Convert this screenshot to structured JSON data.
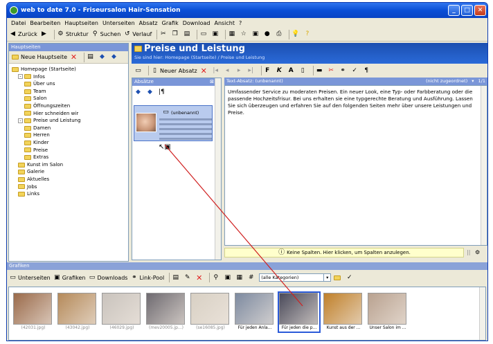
{
  "window": {
    "title": "web to date 7.0 - Friseursalon Hair-Sensation"
  },
  "menu": [
    "Datei",
    "Bearbeiten",
    "Hauptseiten",
    "Unterseiten",
    "Absatz",
    "Grafik",
    "Download",
    "Ansicht",
    "?"
  ],
  "toolbar": {
    "back": "Zurück",
    "structure": "Struktur",
    "search": "Suchen",
    "history": "Verlauf"
  },
  "left": {
    "header": "Hauptseiten",
    "new_page": "Neue Hauptseite",
    "tree": [
      {
        "label": "Homepage (Startseite)",
        "level": 0,
        "toggle": ""
      },
      {
        "label": "Infos",
        "level": 1,
        "toggle": "-"
      },
      {
        "label": "Über uns",
        "level": 2,
        "toggle": ""
      },
      {
        "label": "Team",
        "level": 2,
        "toggle": ""
      },
      {
        "label": "Salon",
        "level": 2,
        "toggle": ""
      },
      {
        "label": "Öffnungszeiten",
        "level": 2,
        "toggle": ""
      },
      {
        "label": "Hier schneiden wir",
        "level": 2,
        "toggle": ""
      },
      {
        "label": "Preise und Leistung",
        "level": 1,
        "toggle": "-"
      },
      {
        "label": "Damen",
        "level": 2,
        "toggle": ""
      },
      {
        "label": "Herren",
        "level": 2,
        "toggle": ""
      },
      {
        "label": "Kinder",
        "level": 2,
        "toggle": ""
      },
      {
        "label": "Preise",
        "level": 2,
        "toggle": ""
      },
      {
        "label": "Extras",
        "level": 2,
        "toggle": ""
      },
      {
        "label": "Kunst im Salon",
        "level": 1,
        "toggle": ""
      },
      {
        "label": "Galerie",
        "level": 1,
        "toggle": ""
      },
      {
        "label": "Aktuelles",
        "level": 1,
        "toggle": ""
      },
      {
        "label": "Jobs",
        "level": 1,
        "toggle": ""
      },
      {
        "label": "Links",
        "level": 1,
        "toggle": ""
      }
    ]
  },
  "page": {
    "title": "Preise und Leistung",
    "breadcrumb": "Sie sind hier: Homepage (Startseite) / Preise und Leistung",
    "new_paragraph": "Neuer Absatz"
  },
  "absatz": {
    "header": "Absätze",
    "card_label": "(unbenannt)"
  },
  "text": {
    "header": "Text-Absatz: (unbenannt)",
    "assign": "(nicht zugeordnet)",
    "pager": "1/1",
    "body": "Umfassender Service zu moderaten Preisen. Ein neuer Look, eine Typ- oder Farbberatung oder die passende Hochzeitsfrisur. Bei uns erhalten sie eine typgerechte Beratung und Ausführung. Lassen Sie sich überzeugen und erfahren Sie auf den folgenden Seiten mehr über unsere Leistungen und Preise.",
    "spalten": "Keine Spalten. Hier klicken, um Spalten anzulegen."
  },
  "grafiken": {
    "header": "Grafiken",
    "tabs": [
      "Unterseiten",
      "Grafiken",
      "Downloads",
      "Link-Pool"
    ],
    "category": "(alle Kategorien)",
    "thumbs": [
      {
        "cap": "(42031.jpg)",
        "gray": true,
        "color": "#9a6a4a"
      },
      {
        "cap": "(43042.jpg)",
        "gray": true,
        "color": "#b58a5a"
      },
      {
        "cap": "(46029.jpg)",
        "gray": true,
        "color": "#c9c3bd"
      },
      {
        "cap": "(mev20005.jp...)",
        "gray": true,
        "color": "#6e6a70"
      },
      {
        "cap": "(se16085.jpg)",
        "gray": true,
        "color": "#d8d0c4"
      },
      {
        "cap": "Für jeden Anla...",
        "gray": false,
        "color": "#7d8aa0"
      },
      {
        "cap": "Für jeden die p...",
        "gray": false,
        "color": "#4a4a5a"
      },
      {
        "cap": "Kunst aus der ...",
        "gray": false,
        "color": "#c0802a"
      },
      {
        "cap": "Unser Salon im ...",
        "gray": false,
        "color": "#b9a290"
      }
    ]
  },
  "colors": {
    "title_blue": "#0a4fd6",
    "header_blue": "#1c4fb0",
    "drag_line": "#d02020",
    "delete_red": "#e02020"
  }
}
